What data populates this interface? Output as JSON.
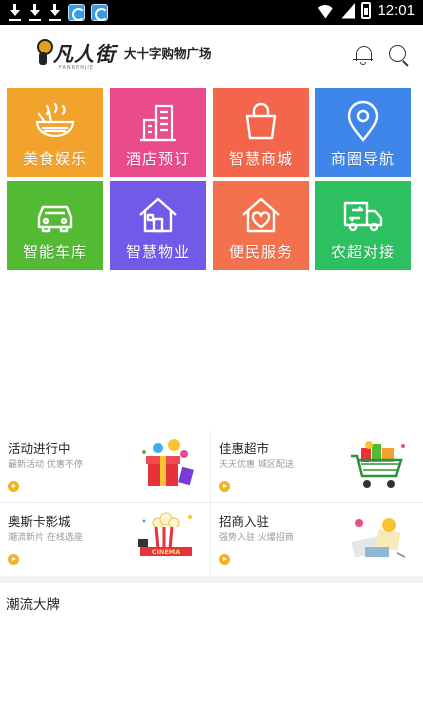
{
  "statusbar": {
    "time": "12:01"
  },
  "header": {
    "brand": "凡人街",
    "subtitle": "大十字购物广场",
    "brand_pinyin": "FANRENJIE"
  },
  "tiles": [
    {
      "label": "美食娱乐",
      "icon": "noodle-bowl-icon",
      "color": "#f1a32c"
    },
    {
      "label": "酒店预订",
      "icon": "hotel-building-icon",
      "color": "#e94b8b"
    },
    {
      "label": "智慧商城",
      "icon": "shopping-bag-icon",
      "color": "#f3664b"
    },
    {
      "label": "商圈导航",
      "icon": "location-pin-icon",
      "color": "#3f86ea"
    },
    {
      "label": "智能车库",
      "icon": "car-icon",
      "color": "#52ba33"
    },
    {
      "label": "智慧物业",
      "icon": "house-icon",
      "color": "#7359e8"
    },
    {
      "label": "便民服务",
      "icon": "heart-house-icon",
      "color": "#f3724d"
    },
    {
      "label": "农超对接",
      "icon": "delivery-truck-icon",
      "color": "#2dc060"
    }
  ],
  "promos": [
    {
      "title": "活动进行中",
      "desc": "最新活动 优惠不停"
    },
    {
      "title": "佳惠超市",
      "desc": "天天优惠 城区配送"
    },
    {
      "title": "奥斯卡影城",
      "desc": "潮流新片 在线选座"
    },
    {
      "title": "招商入驻",
      "desc": "强势入驻 火爆招商"
    }
  ],
  "section": {
    "title": "潮流大牌"
  },
  "cinema_text": "CINEMA"
}
